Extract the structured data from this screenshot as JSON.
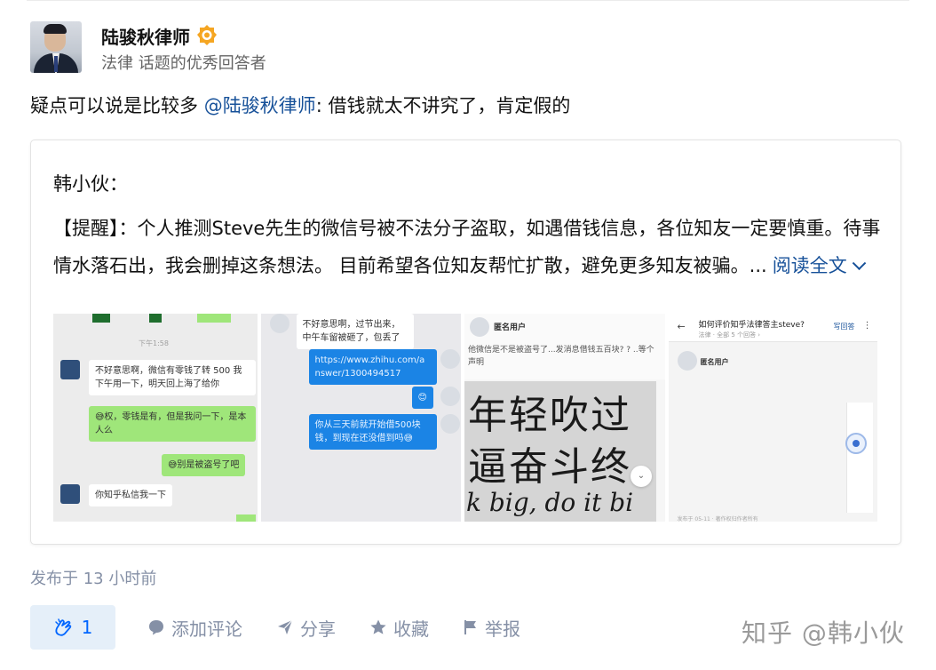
{
  "author": {
    "name": "陆骏秋律师",
    "description": "法律 话题的优秀回答者",
    "badge_icon": "verified-gold-badge-icon"
  },
  "comment": {
    "prefix": "疑点可以说是比较多 ",
    "mention": "@陆骏秋律师",
    "suffix": ": 借钱就太不讲究了，肯定假的"
  },
  "quoted_post": {
    "author": "韩小伙：",
    "text": "【提醒】：个人推测Steve先生的微信号被不法分子盗取，如遇借钱信息，各位知友一定要慎重。待事情水落石出，我会删掉这条想法。 目前希望各位知友帮忙扩散，避免更多知友被骗。...",
    "read_more": "阅读全文",
    "images": {
      "img1": {
        "time": "下午1:58",
        "msg1": "不好意思啊，微信有零钱了转 500 我下午用一下，明天回上海了给你",
        "msg2": "😅权，零钱是有，但是我问一下，是本人么",
        "msg3": "😅别是被盗号了吧",
        "msg4": "你知乎私信我一下"
      },
      "img2": {
        "msg1": "不好意思啊，过节出来，中午车留被砸了，包丢了",
        "link": "https://www.zhihu.com/answer/1300494517",
        "emoji": "😊",
        "msg3": "你从三天前就开始借500块钱，到现在还没借到吗😅"
      },
      "img3": {
        "user": "匿名用户",
        "question": "他微信是不是被盗号了...发消息借钱五百块? ? ..等个声明",
        "calligraphy_line1": "年轻吹过",
        "calligraphy_line2": "逼奋斗终",
        "calligraphy_line3": "k big, do it bi",
        "scroll_icon": "chevron-double-down-icon"
      },
      "img4": {
        "title": "如何评价知乎法律答主steve?",
        "subtitle": "法律 · 全部 5 个回答 ›",
        "button": "写回答",
        "user": "匿名用户",
        "footer": "发布于 05-11 · 著作权归作者所有"
      }
    }
  },
  "publish_time": "发布于 13 小时前",
  "actions": {
    "like_count": "1",
    "comment": "添加评论",
    "share": "分享",
    "favorite": "收藏",
    "report": "举报"
  },
  "watermark": "知乎 @韩小伙"
}
